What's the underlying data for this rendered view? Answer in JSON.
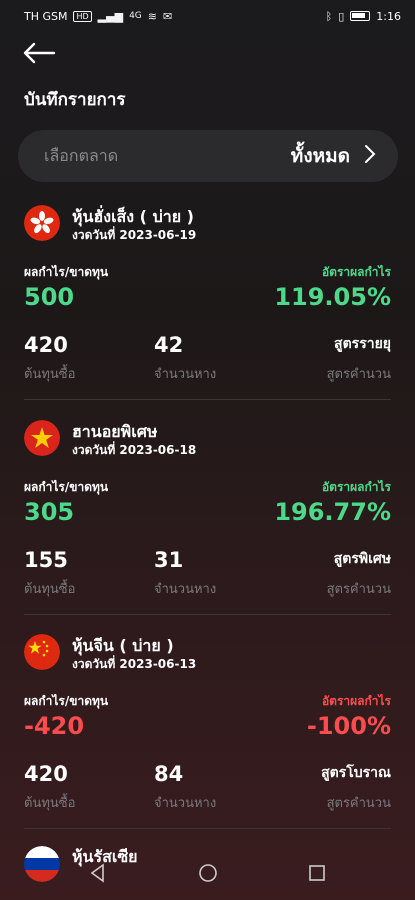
{
  "status_bar": {
    "carrier": "TH GSM",
    "carrier_badge": "HD",
    "network": "4G",
    "time": "1:16"
  },
  "header": {
    "title": "บันทึกรายการ"
  },
  "market_selector": {
    "placeholder": "เลือกตลาด",
    "value": "ทั้งหมด"
  },
  "labels": {
    "profit_loss": "ผลกำไร/ขาดทุน",
    "profit_rate": "อัตราผลกำไร",
    "cost": "ต้นทุนซื้อ",
    "quantity": "จำนวนหาง",
    "formula_calc": "สูตรคำนวน"
  },
  "records": [
    {
      "flag": "hong-kong",
      "name": "หุ้นฮั่งเส็ง ( บ่าย )",
      "date": "งวดวันที่ 2023-06-19",
      "profit": "500",
      "rate": "119.05%",
      "status": "positive",
      "cost": "420",
      "quantity": "42",
      "formula": "สูตรรายยุ"
    },
    {
      "flag": "vietnam",
      "name": "ฮานอยพิเศษ",
      "date": "งวดวันที่ 2023-06-18",
      "profit": "305",
      "rate": "196.77%",
      "status": "positive",
      "cost": "155",
      "quantity": "31",
      "formula": "สูตรพิเศษ"
    },
    {
      "flag": "china",
      "name": "หุ้นจีน ( บ่าย )",
      "date": "งวดวันที่ 2023-06-13",
      "profit": "-420",
      "rate": "-100%",
      "status": "negative",
      "cost": "420",
      "quantity": "84",
      "formula": "สูตรโบราณ"
    }
  ],
  "partial_record": {
    "flag": "russia",
    "name": "หุ้นรัสเซีย"
  },
  "colors": {
    "positive": "#4cd98a",
    "negative": "#ff4d4f",
    "muted": "#7a7a7e"
  }
}
